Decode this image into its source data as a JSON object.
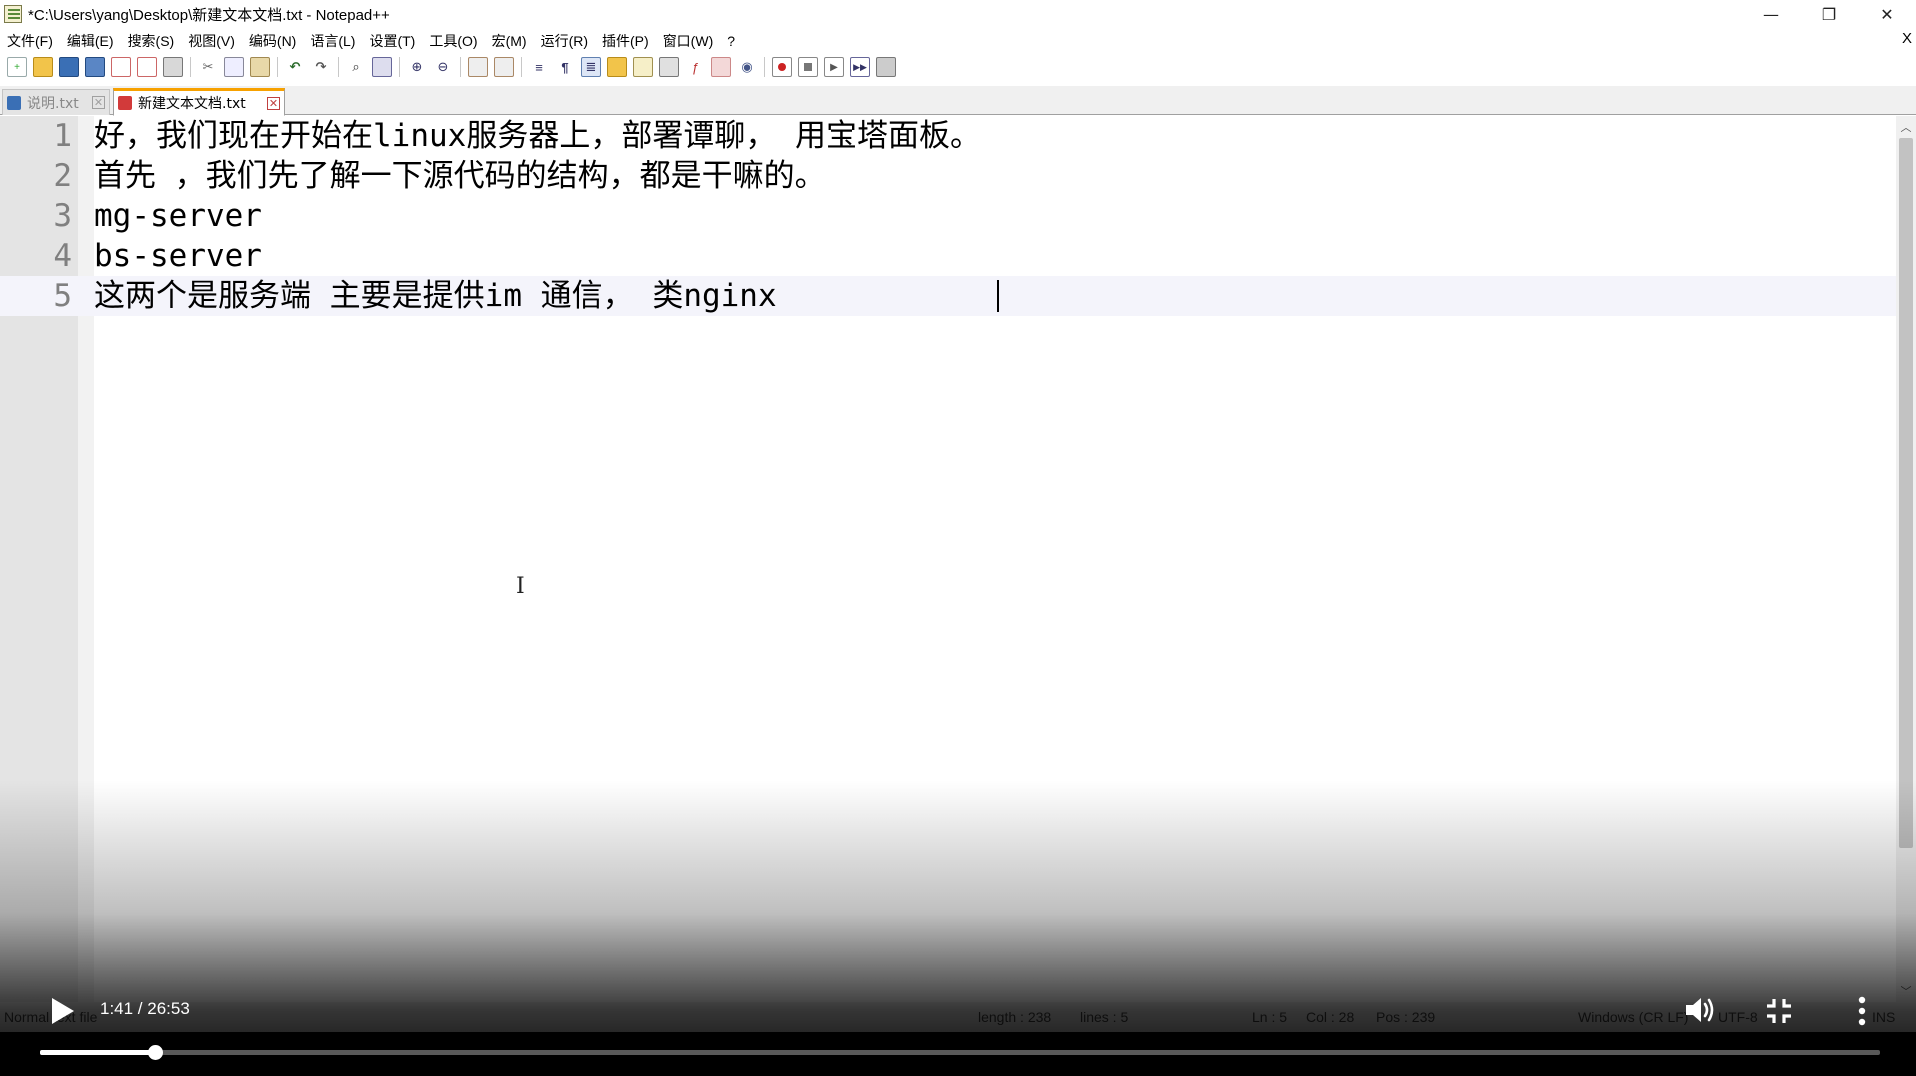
{
  "window": {
    "title": "*C:\\Users\\yang\\Desktop\\新建文本文档.txt - Notepad++",
    "minimize": "—",
    "restore": "❐",
    "close": "✕"
  },
  "menu": {
    "items": [
      "文件(F)",
      "编辑(E)",
      "搜索(S)",
      "视图(V)",
      "编码(N)",
      "语言(L)",
      "设置(T)",
      "工具(O)",
      "宏(M)",
      "运行(R)",
      "插件(P)",
      "窗口(W)",
      "?"
    ],
    "close_doc": "X"
  },
  "tabs": [
    {
      "label": "说明.txt",
      "state": "inactive",
      "close": "✕"
    },
    {
      "label": "新建文本文档.txt",
      "state": "active",
      "close": "✕"
    }
  ],
  "editor": {
    "lines": [
      {
        "num": "1",
        "text": "好，我们现在开始在linux服务器上，部署谭聊， 用宝塔面板。"
      },
      {
        "num": "2",
        "text": "首先 ，我们先了解一下源代码的结构，都是干嘛的。"
      },
      {
        "num": "3",
        "text": "mg-server"
      },
      {
        "num": "4",
        "text": "bs-server"
      },
      {
        "num": "5",
        "text": "这两个是服务端 主要是提供im 通信， 类nginx "
      }
    ],
    "current_line": 5,
    "mouse_cursor": "I"
  },
  "statusbar": {
    "type": "Normal text file",
    "length": "length : 238",
    "lines": "lines : 5",
    "ln": "Ln : 5",
    "col": "Col : 28",
    "pos": "Pos : 239",
    "eol": "Windows (CR LF)",
    "encoding": "UTF-8",
    "mode": "INS"
  },
  "video": {
    "time": "1:41 / 26:53",
    "progress": 0.0626
  },
  "colors": {
    "tab_accent": "#f7a100",
    "gutter": "#e4e4e4",
    "current_line": "#f4f4fb"
  }
}
